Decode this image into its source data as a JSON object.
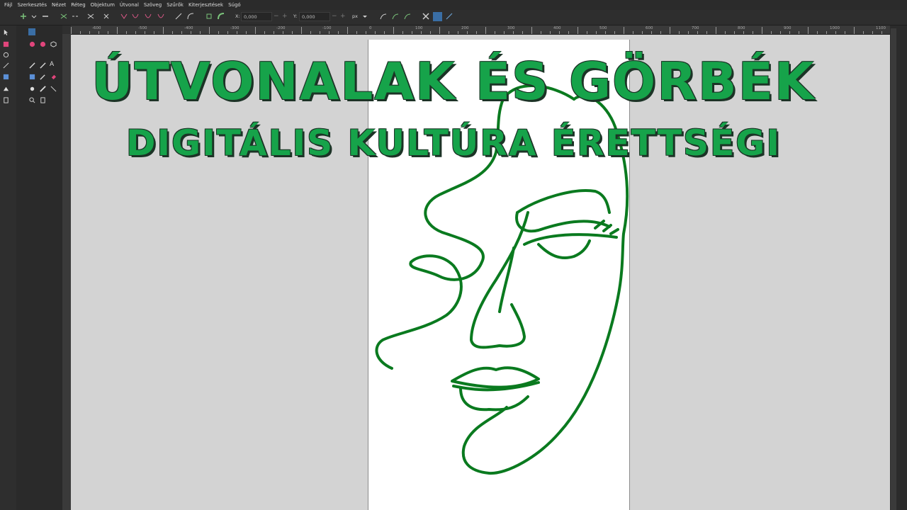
{
  "menu": [
    "Fájl",
    "Szerkesztés",
    "Nézet",
    "Réteg",
    "Objektum",
    "Útvonal",
    "Szöveg",
    "Szűrők",
    "Kiterjesztések",
    "Súgó"
  ],
  "toolbar": {
    "x_label": "X:",
    "x_value": "0,000",
    "y_label": "Y:",
    "y_value": "0,000",
    "unit": "px"
  },
  "ruler": {
    "labels": [
      "-600",
      "-500",
      "-400",
      "-300",
      "-200",
      "-100",
      "0",
      "100",
      "200",
      "300",
      "400",
      "500",
      "600",
      "700",
      "800",
      "900",
      "1000",
      "1100"
    ]
  },
  "overlay": {
    "title": "ÚTVONALAK ÉS GÖRBÉK",
    "subtitle": "DIGITÁLIS KULTÚRA ÉRETTSÉGI"
  },
  "colors": {
    "accent": "#16a34a",
    "stroke": "#0a7a1f",
    "canvas": "#d3d3d3"
  }
}
